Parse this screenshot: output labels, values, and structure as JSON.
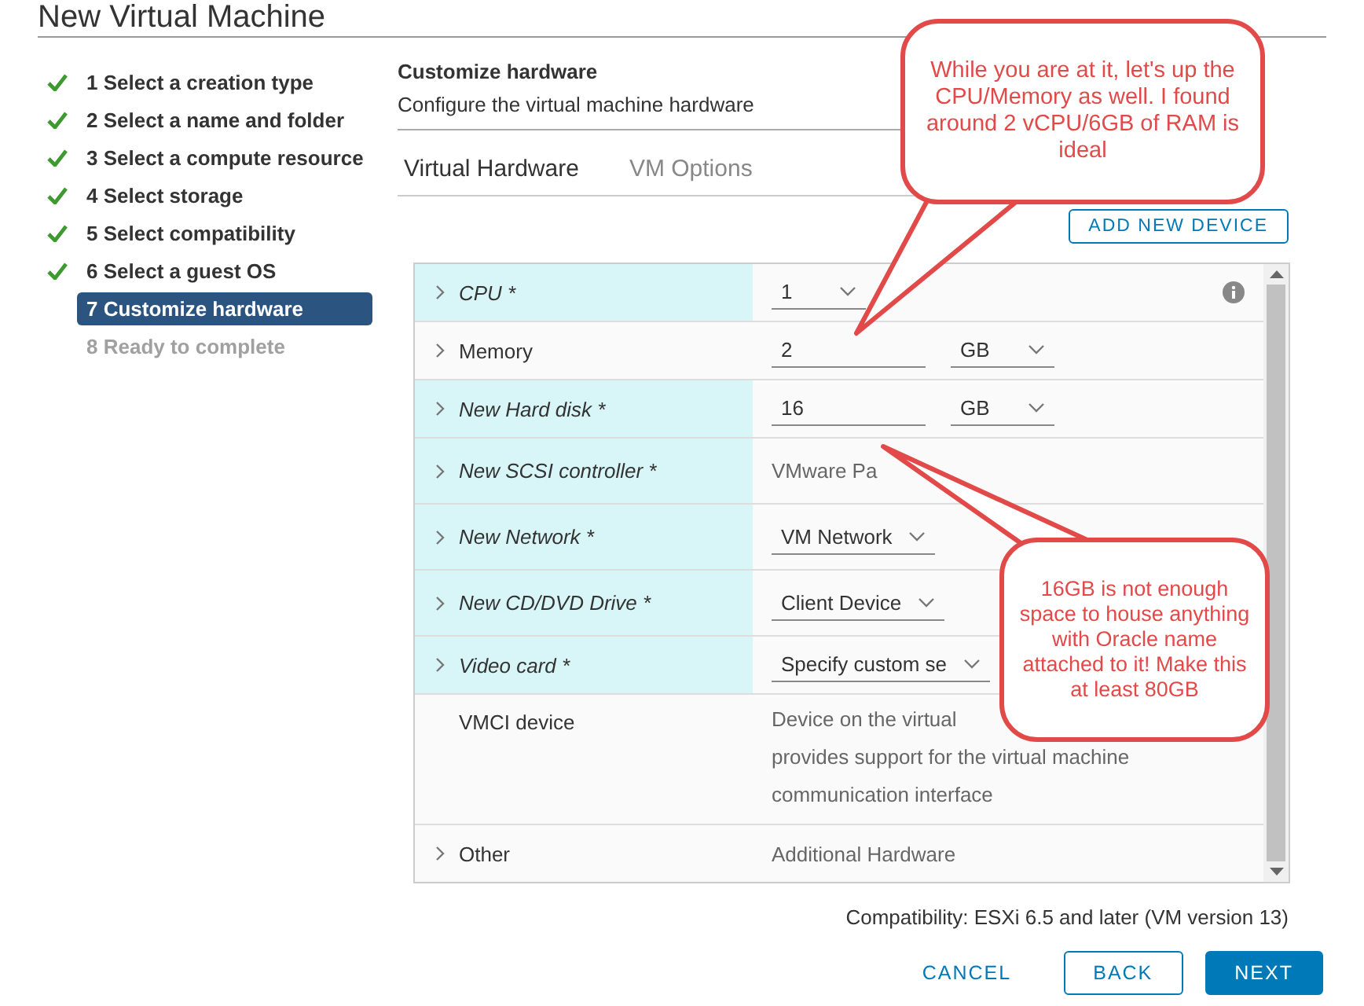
{
  "window": {
    "title": "New Virtual Machine"
  },
  "steps": [
    {
      "label": "1 Select a creation type",
      "done": true,
      "selected": false,
      "disabled": false
    },
    {
      "label": "2 Select a name and folder",
      "done": true,
      "selected": false,
      "disabled": false
    },
    {
      "label": "3 Select a compute resource",
      "done": true,
      "selected": false,
      "disabled": false
    },
    {
      "label": "4 Select storage",
      "done": true,
      "selected": false,
      "disabled": false
    },
    {
      "label": "5 Select compatibility",
      "done": true,
      "selected": false,
      "disabled": false
    },
    {
      "label": "6 Select a guest OS",
      "done": true,
      "selected": false,
      "disabled": false
    },
    {
      "label": "7 Customize hardware",
      "done": false,
      "selected": true,
      "disabled": false
    },
    {
      "label": "8 Ready to complete",
      "done": false,
      "selected": false,
      "disabled": true
    }
  ],
  "header": {
    "title": "Customize hardware",
    "subtitle": "Configure the virtual machine hardware"
  },
  "tabs": [
    {
      "label": "Virtual Hardware",
      "selected": true
    },
    {
      "label": "VM Options",
      "selected": false
    }
  ],
  "add_button": "ADD NEW DEVICE",
  "hardware": [
    {
      "label": "CPU *",
      "modified": true,
      "expandable": true,
      "kind": "select",
      "value": "1",
      "info": true
    },
    {
      "label": "Memory",
      "modified": false,
      "expandable": true,
      "kind": "size",
      "value": "2",
      "unit": "GB"
    },
    {
      "label": "New Hard disk *",
      "modified": true,
      "expandable": true,
      "kind": "size",
      "value": "16",
      "unit": "GB"
    },
    {
      "label": "New SCSI controller *",
      "modified": true,
      "expandable": true,
      "kind": "text",
      "value": "VMware Pa"
    },
    {
      "label": "New Network *",
      "modified": true,
      "expandable": true,
      "kind": "select",
      "value": "VM Network"
    },
    {
      "label": "New CD/DVD Drive *",
      "modified": true,
      "expandable": true,
      "kind": "select",
      "value": "Client Device"
    },
    {
      "label": "Video card *",
      "modified": true,
      "expandable": true,
      "kind": "select",
      "value": "Specify custom se"
    },
    {
      "label": "VMCI device",
      "modified": false,
      "expandable": false,
      "kind": "lines",
      "lines": [
        "Device on the virtual",
        "provides support for the virtual machine",
        "communication interface"
      ]
    },
    {
      "label": "Other",
      "modified": false,
      "expandable": true,
      "kind": "text",
      "value": "Additional Hardware"
    }
  ],
  "compatibility": "Compatibility: ESXi 6.5 and later (VM version 13)",
  "buttons": [
    {
      "label": "CANCEL",
      "kind": "flat"
    },
    {
      "label": "BACK",
      "kind": "outline"
    },
    {
      "label": "NEXT",
      "kind": "primary"
    }
  ],
  "callouts": [
    {
      "text": "While you are at it, let's up the CPU/Memory as well. I found around 2 vCPU/6GB of RAM is ideal"
    },
    {
      "text": "16GB is not enough space to house anything with Oracle name attached to it! Make this at least 80GB"
    }
  ]
}
